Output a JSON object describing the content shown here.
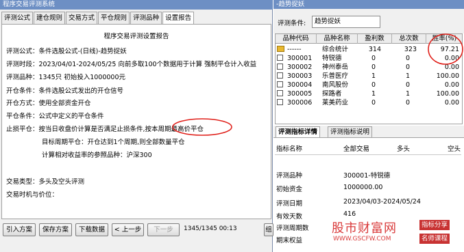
{
  "left_window": {
    "title": "程序交易评测系统",
    "tabs": [
      "评测公式",
      "建仓规则",
      "交易方式",
      "平仓规则",
      "评测品种",
      "设置报告"
    ],
    "active_tab": "设置报告",
    "report_title": "程序交易评测设置报告",
    "report_lines": [
      "评测公式：条件选股公式-(日线)-趋势捉妖",
      "评测时段：2023/04/01-2024/05/25 向前多取100个数据用于计算 强制平仓计入收益",
      "评测品种：1345只 初始投入1000000元",
      "开仓条件：条件选股公式发出的开仓信号",
      "开仓方式：使用全部资金开仓",
      "平仓条件：公式中定义的平仓条件",
      "止损平仓：按当日收盘价计算是否满足止损条件,按本周期最高价平仓",
      "目标周期平仓：开仓达到1个周期,则全部数量平仓",
      "计算相对收益率的参照品种：沪深300",
      "交易类型：多头及空头评测",
      "交易时机与价位："
    ],
    "buttons": {
      "import": "引入方案",
      "save": "保存方案",
      "download": "下载数据",
      "prev": "< 上一步",
      "next": "下一步",
      "right_edge": "组"
    },
    "progress_text": "1345/1345 00:13"
  },
  "right_window": {
    "title": "-趋势捉妖",
    "condition_label": "评测条件:",
    "condition_value": "趋势捉妖",
    "table": {
      "headers": [
        "品种代码",
        "品种名称",
        "盈利数",
        "总次数",
        "胜率(%)"
      ],
      "rows": [
        [
          "------",
          "综合统计",
          "314",
          "323",
          "97.21"
        ],
        [
          "300001",
          "特锐德",
          "0",
          "0",
          "0.00"
        ],
        [
          "300002",
          "神州泰岳",
          "0",
          "0",
          "0.00"
        ],
        [
          "300003",
          "乐普医疗",
          "1",
          "1",
          "100.00"
        ],
        [
          "300004",
          "南风股份",
          "0",
          "0",
          "0.00"
        ],
        [
          "300005",
          "探路者",
          "1",
          "1",
          "100.00"
        ],
        [
          "300006",
          "莱美药业",
          "0",
          "0",
          "0.00"
        ]
      ]
    },
    "bottom_tabs": [
      "评测指标详情",
      "评测指标说明"
    ],
    "detail_headers": [
      "指标名称",
      "全部交易",
      "多头",
      "空头"
    ],
    "details": [
      {
        "k": "评测品种",
        "v": "300001-特锐德"
      },
      {
        "k": "初始资金",
        "v": "1000000.00"
      },
      {
        "k": "评测日期",
        "v": "2023/04/03-2024/05/24"
      },
      {
        "k": "有效天数",
        "v": "416"
      },
      {
        "k": "评测周期数",
        "v": ""
      },
      {
        "k": "期末权益",
        "v": ""
      }
    ]
  },
  "watermark": {
    "brand": "股市财富网",
    "url": "WWW.GSCFW.COM",
    "badge1": "指标分享",
    "badge2": "名师课程"
  },
  "colors": {
    "titlebar": "#6d8fc4",
    "annotation_circle": "#e0201a",
    "watermark": "#d93a3a"
  }
}
